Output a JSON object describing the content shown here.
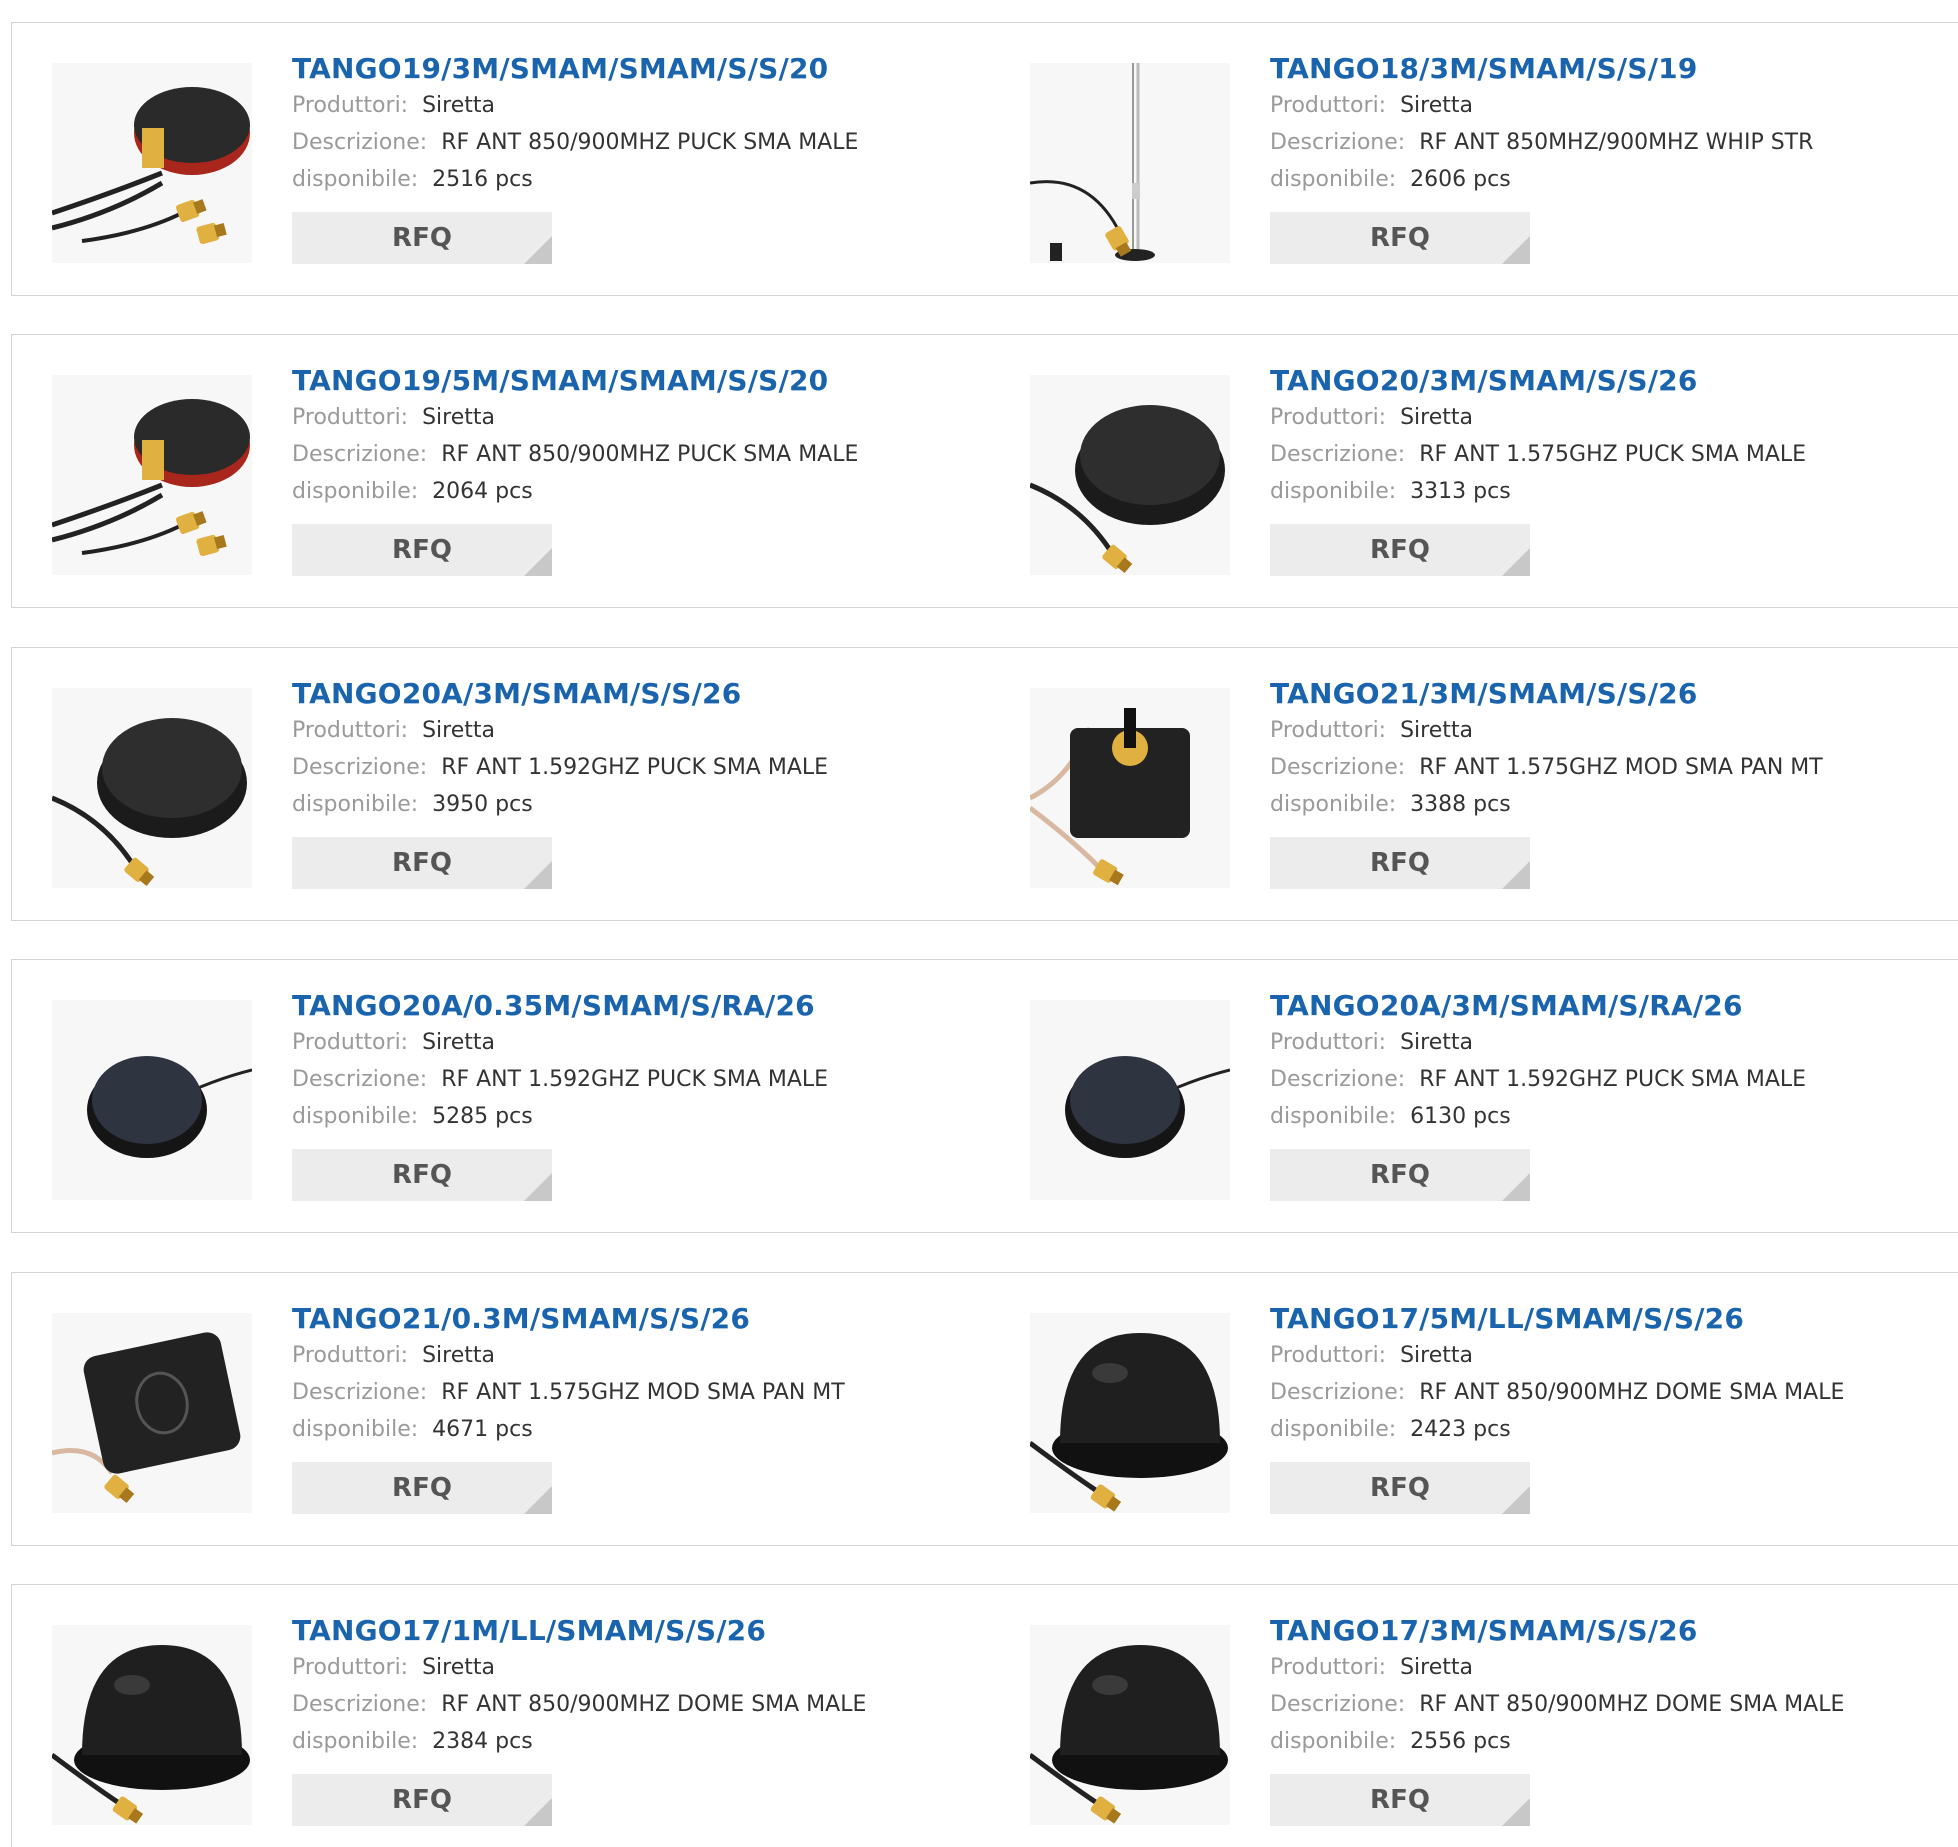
{
  "labels": {
    "manufacturer": "Produttori:",
    "description": "Descrizione:",
    "available": "disponibile:",
    "rfq": "RFQ"
  },
  "products": [
    {
      "part": "TANGO19/3M/SMAM/SMAM/S/S/20",
      "manufacturer": "Siretta",
      "description": "RF ANT 850/900MHZ PUCK SMA MALE",
      "available": "2516 pcs",
      "image": "red-puck-dual-cable"
    },
    {
      "part": "TANGO18/3M/SMAM/S/S/19",
      "manufacturer": "Siretta",
      "description": "RF ANT 850MHZ/900MHZ WHIP STR",
      "available": "2606 pcs",
      "image": "whip-antenna"
    },
    {
      "part": "TANGO19/5M/SMAM/SMAM/S/S/20",
      "manufacturer": "Siretta",
      "description": "RF ANT 850/900MHZ PUCK SMA MALE",
      "available": "2064 pcs",
      "image": "red-puck-dual-cable"
    },
    {
      "part": "TANGO20/3M/SMAM/S/S/26",
      "manufacturer": "Siretta",
      "description": "RF ANT 1.575GHZ PUCK SMA MALE",
      "available": "3313 pcs",
      "image": "black-puck"
    },
    {
      "part": "TANGO20A/3M/SMAM/S/S/26",
      "manufacturer": "Siretta",
      "description": "RF ANT 1.592GHZ PUCK SMA MALE",
      "available": "3950 pcs",
      "image": "black-puck"
    },
    {
      "part": "TANGO21/3M/SMAM/S/S/26",
      "manufacturer": "Siretta",
      "description": "RF ANT 1.575GHZ MOD SMA PAN MT",
      "available": "3388 pcs",
      "image": "square-module"
    },
    {
      "part": "TANGO20A/0.35M/SMAM/S/RA/26",
      "manufacturer": "Siretta",
      "description": "RF ANT 1.592GHZ PUCK SMA MALE",
      "available": "5285 pcs",
      "image": "small-puck"
    },
    {
      "part": "TANGO20A/3M/SMAM/S/RA/26",
      "manufacturer": "Siretta",
      "description": "RF ANT 1.592GHZ PUCK SMA MALE",
      "available": "6130 pcs",
      "image": "small-puck"
    },
    {
      "part": "TANGO21/0.3M/SMAM/S/S/26",
      "manufacturer": "Siretta",
      "description": "RF ANT 1.575GHZ MOD SMA PAN MT",
      "available": "4671 pcs",
      "image": "gps-square"
    },
    {
      "part": "TANGO17/5M/LL/SMAM/S/S/26",
      "manufacturer": "Siretta",
      "description": "RF ANT 850/900MHZ DOME SMA MALE",
      "available": "2423 pcs",
      "image": "dome"
    },
    {
      "part": "TANGO17/1M/LL/SMAM/S/S/26",
      "manufacturer": "Siretta",
      "description": "RF ANT 850/900MHZ DOME SMA MALE",
      "available": "2384 pcs",
      "image": "dome"
    },
    {
      "part": "TANGO17/3M/SMAM/S/S/26",
      "manufacturer": "Siretta",
      "description": "RF ANT 850/900MHZ DOME SMA MALE",
      "available": "2556 pcs",
      "image": "dome"
    }
  ],
  "colors": {
    "title": "#1a64ad",
    "label": "#9a9a9a",
    "value": "#333333",
    "button_bg": "#ececec",
    "border": "#d4d4d4"
  }
}
